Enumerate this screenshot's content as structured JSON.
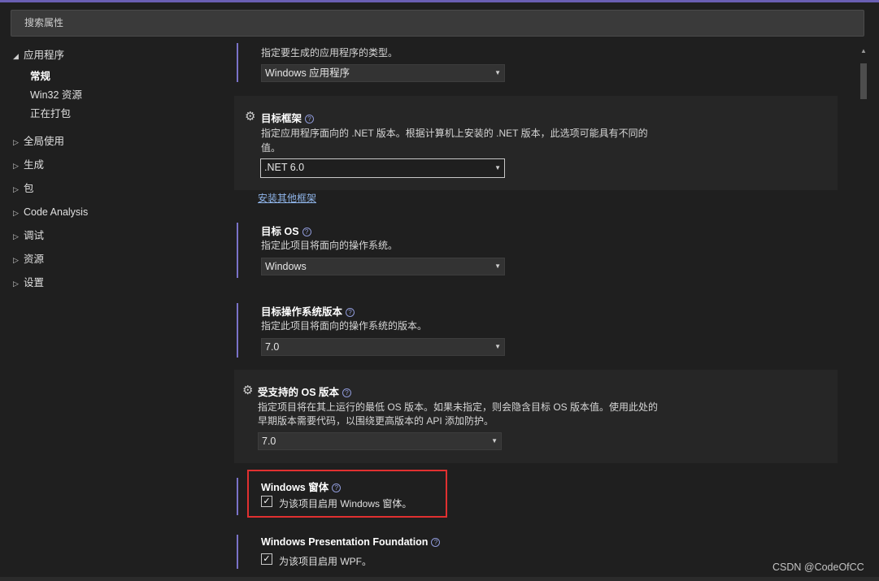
{
  "search": {
    "placeholder": "搜索属性"
  },
  "sidebar": {
    "groups": [
      {
        "label": "应用程序",
        "expanded": true,
        "children": [
          {
            "label": "常规",
            "active": true
          },
          {
            "label": "Win32 资源"
          },
          {
            "label": "正在打包"
          }
        ]
      },
      {
        "label": "全局使用"
      },
      {
        "label": "生成"
      },
      {
        "label": "包"
      },
      {
        "label": "Code Analysis"
      },
      {
        "label": "调试"
      },
      {
        "label": "资源"
      },
      {
        "label": "设置"
      }
    ],
    "arrow_expanded": "◢",
    "arrow_collapsed": "▷"
  },
  "output_type": {
    "desc": "指定要生成的应用程序的类型。",
    "value": "Windows 应用程序"
  },
  "target_framework": {
    "title": "目标框架",
    "desc_line1": "指定应用程序面向的 .NET 版本。根据计算机上安装的 .NET 版本，此选项可能具有不同的",
    "desc_line2": "值。",
    "value": ".NET 6.0",
    "install_link": "安装其他框架"
  },
  "target_os": {
    "title": "目标 OS",
    "desc": "指定此项目将面向的操作系统。",
    "value": "Windows"
  },
  "target_os_version": {
    "title": "目标操作系统版本",
    "desc": "指定此项目将面向的操作系统的版本。",
    "value": "7.0"
  },
  "supported_os_version": {
    "title": "受支持的 OS 版本",
    "desc_line1": "指定项目将在其上运行的最低 OS 版本。如果未指定，则会隐含目标 OS 版本值。使用此处的",
    "desc_line2": "早期版本需要代码，以围绕更高版本的 API 添加防护。",
    "value": "7.0"
  },
  "windows_forms": {
    "title": "Windows 窗体",
    "checkbox_label": "为该项目启用 Windows 窗体。",
    "checked": true
  },
  "wpf": {
    "title": "Windows Presentation Foundation",
    "checkbox_label": "为该项目启用 WPF。",
    "checked": true
  },
  "icons": {
    "help": "?",
    "gear": "⚙",
    "caret": "▼",
    "check": "✓",
    "scroll_up": "▲"
  },
  "watermark": "CSDN @CodeOfCC",
  "colors": {
    "accent": "#7a72c8",
    "link": "#8fb4e8",
    "highlight_box": "#e03030"
  }
}
